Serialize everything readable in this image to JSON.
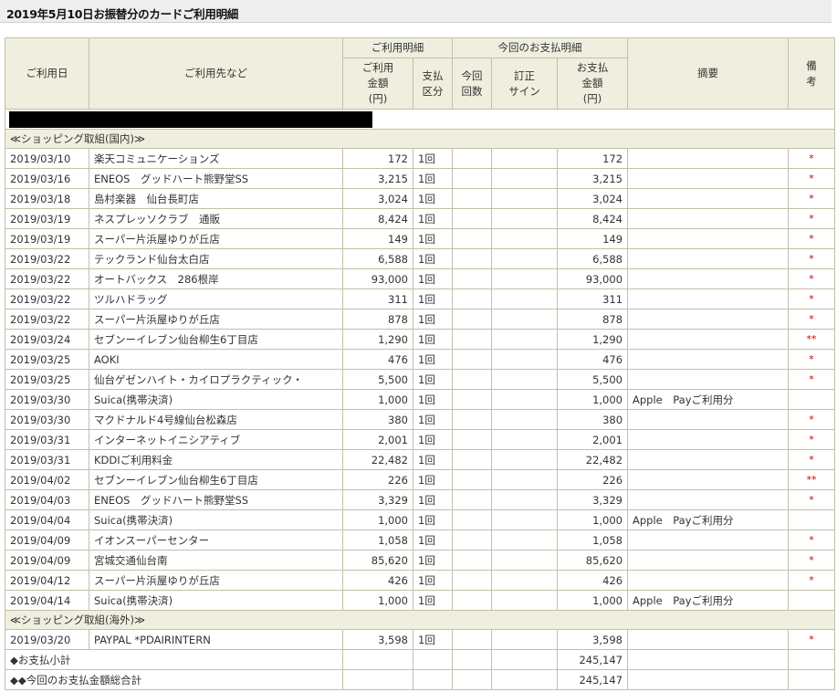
{
  "page": {
    "title": "2019年5月10日お振替分のカードご利用明細"
  },
  "headers": {
    "date": "ご利用日",
    "merchant": "ご利用先など",
    "usage_group": "ご利用明細",
    "payment_group": "今回のお支払明細",
    "amount": "ご利用\n金額\n(円)",
    "pay_type": "支払\n区分",
    "this_count": "今回\n回数",
    "correction": "訂正\nサイン",
    "payment_amount": "お支払\n金額\n(円)",
    "summary": "摘要",
    "notes": "備\n考"
  },
  "sections": [
    {
      "label": "≪ショッピング取組(国内)≫",
      "rows": [
        {
          "date": "2019/03/10",
          "merchant": "楽天コミュニケーションズ",
          "amount": "172",
          "pay": "1回",
          "count": "",
          "sign": "",
          "payment": "172",
          "summary": "",
          "note": "*"
        },
        {
          "date": "2019/03/16",
          "merchant": "ENEOS　グッドハート熊野堂SS",
          "amount": "3,215",
          "pay": "1回",
          "count": "",
          "sign": "",
          "payment": "3,215",
          "summary": "",
          "note": "*"
        },
        {
          "date": "2019/03/18",
          "merchant": "島村楽器　仙台長町店",
          "amount": "3,024",
          "pay": "1回",
          "count": "",
          "sign": "",
          "payment": "3,024",
          "summary": "",
          "note": "*"
        },
        {
          "date": "2019/03/19",
          "merchant": "ネスプレッソクラブ　通販",
          "amount": "8,424",
          "pay": "1回",
          "count": "",
          "sign": "",
          "payment": "8,424",
          "summary": "",
          "note": "*"
        },
        {
          "date": "2019/03/19",
          "merchant": "スーパー片浜屋ゆりが丘店",
          "amount": "149",
          "pay": "1回",
          "count": "",
          "sign": "",
          "payment": "149",
          "summary": "",
          "note": "*"
        },
        {
          "date": "2019/03/22",
          "merchant": "テックランド仙台太白店",
          "amount": "6,588",
          "pay": "1回",
          "count": "",
          "sign": "",
          "payment": "6,588",
          "summary": "",
          "note": "*"
        },
        {
          "date": "2019/03/22",
          "merchant": "オートバックス　286根岸",
          "amount": "93,000",
          "pay": "1回",
          "count": "",
          "sign": "",
          "payment": "93,000",
          "summary": "",
          "note": "*"
        },
        {
          "date": "2019/03/22",
          "merchant": "ツルハドラッグ",
          "amount": "311",
          "pay": "1回",
          "count": "",
          "sign": "",
          "payment": "311",
          "summary": "",
          "note": "*"
        },
        {
          "date": "2019/03/22",
          "merchant": "スーパー片浜屋ゆりが丘店",
          "amount": "878",
          "pay": "1回",
          "count": "",
          "sign": "",
          "payment": "878",
          "summary": "",
          "note": "*"
        },
        {
          "date": "2019/03/24",
          "merchant": "セブンーイレブン仙台柳生6丁目店",
          "amount": "1,290",
          "pay": "1回",
          "count": "",
          "sign": "",
          "payment": "1,290",
          "summary": "",
          "note": "**"
        },
        {
          "date": "2019/03/25",
          "merchant": "AOKI",
          "amount": "476",
          "pay": "1回",
          "count": "",
          "sign": "",
          "payment": "476",
          "summary": "",
          "note": "*"
        },
        {
          "date": "2019/03/25",
          "merchant": "仙台ゲゼンハイト・カイロプラクティック・",
          "amount": "5,500",
          "pay": "1回",
          "count": "",
          "sign": "",
          "payment": "5,500",
          "summary": "",
          "note": "*"
        },
        {
          "date": "2019/03/30",
          "merchant": "Suica(携帯決済)",
          "amount": "1,000",
          "pay": "1回",
          "count": "",
          "sign": "",
          "payment": "1,000",
          "summary": "Apple　Payご利用分",
          "note": ""
        },
        {
          "date": "2019/03/30",
          "merchant": "マクドナルド4号線仙台松森店",
          "amount": "380",
          "pay": "1回",
          "count": "",
          "sign": "",
          "payment": "380",
          "summary": "",
          "note": "*"
        },
        {
          "date": "2019/03/31",
          "merchant": "インターネットイニシアティブ",
          "amount": "2,001",
          "pay": "1回",
          "count": "",
          "sign": "",
          "payment": "2,001",
          "summary": "",
          "note": "*"
        },
        {
          "date": "2019/03/31",
          "merchant": "KDDIご利用料金",
          "amount": "22,482",
          "pay": "1回",
          "count": "",
          "sign": "",
          "payment": "22,482",
          "summary": "",
          "note": "*"
        },
        {
          "date": "2019/04/02",
          "merchant": "セブンーイレブン仙台柳生6丁目店",
          "amount": "226",
          "pay": "1回",
          "count": "",
          "sign": "",
          "payment": "226",
          "summary": "",
          "note": "**"
        },
        {
          "date": "2019/04/03",
          "merchant": "ENEOS　グッドハート熊野堂SS",
          "amount": "3,329",
          "pay": "1回",
          "count": "",
          "sign": "",
          "payment": "3,329",
          "summary": "",
          "note": "*"
        },
        {
          "date": "2019/04/04",
          "merchant": "Suica(携帯決済)",
          "amount": "1,000",
          "pay": "1回",
          "count": "",
          "sign": "",
          "payment": "1,000",
          "summary": "Apple　Payご利用分",
          "note": ""
        },
        {
          "date": "2019/04/09",
          "merchant": "イオンスーパーセンター",
          "amount": "1,058",
          "pay": "1回",
          "count": "",
          "sign": "",
          "payment": "1,058",
          "summary": "",
          "note": "*"
        },
        {
          "date": "2019/04/09",
          "merchant": "宮城交通仙台南",
          "amount": "85,620",
          "pay": "1回",
          "count": "",
          "sign": "",
          "payment": "85,620",
          "summary": "",
          "note": "*"
        },
        {
          "date": "2019/04/12",
          "merchant": "スーパー片浜屋ゆりが丘店",
          "amount": "426",
          "pay": "1回",
          "count": "",
          "sign": "",
          "payment": "426",
          "summary": "",
          "note": "*"
        },
        {
          "date": "2019/04/14",
          "merchant": "Suica(携帯決済)",
          "amount": "1,000",
          "pay": "1回",
          "count": "",
          "sign": "",
          "payment": "1,000",
          "summary": "Apple　Payご利用分",
          "note": ""
        }
      ]
    },
    {
      "label": "≪ショッピング取組(海外)≫",
      "rows": [
        {
          "date": "2019/03/20",
          "merchant": "PAYPAL *PDAIRINTERN",
          "amount": "3,598",
          "pay": "1回",
          "count": "",
          "sign": "",
          "payment": "3,598",
          "summary": "",
          "note": "*"
        }
      ]
    }
  ],
  "totals": [
    {
      "label": "◆お支払小計",
      "value": "245,147"
    },
    {
      "label": "◆◆今回のお支払金額総合計",
      "value": "245,147"
    }
  ],
  "colors": {
    "header_bg": "#f0efdf",
    "border": "#c2c0a8",
    "mark": "#cc0000",
    "title_bar": "#eeeeee"
  }
}
